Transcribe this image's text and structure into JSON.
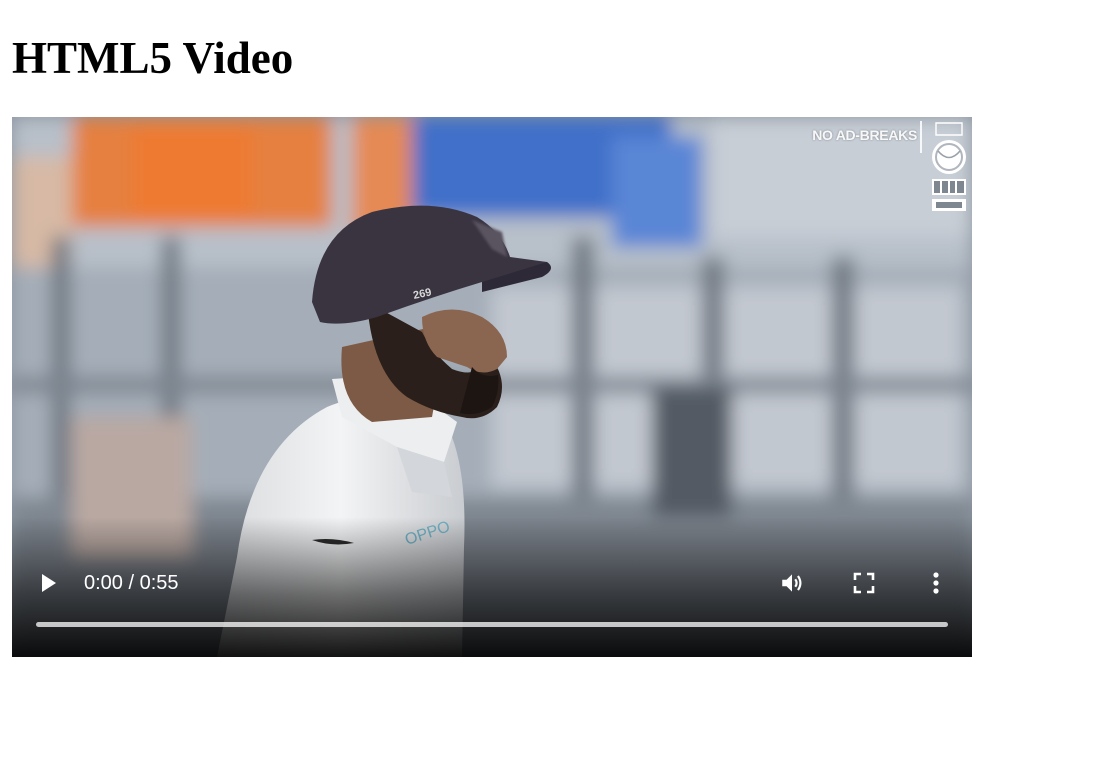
{
  "page": {
    "title": "HTML5 Video"
  },
  "video": {
    "overlay_text": "NO AD-BREAKS",
    "time_current": "0:00",
    "time_separator": "/",
    "time_duration": "0:55",
    "progress": 0,
    "controls": [
      "play-icon",
      "volume-icon",
      "fullscreen-icon",
      "more-options-icon"
    ]
  }
}
